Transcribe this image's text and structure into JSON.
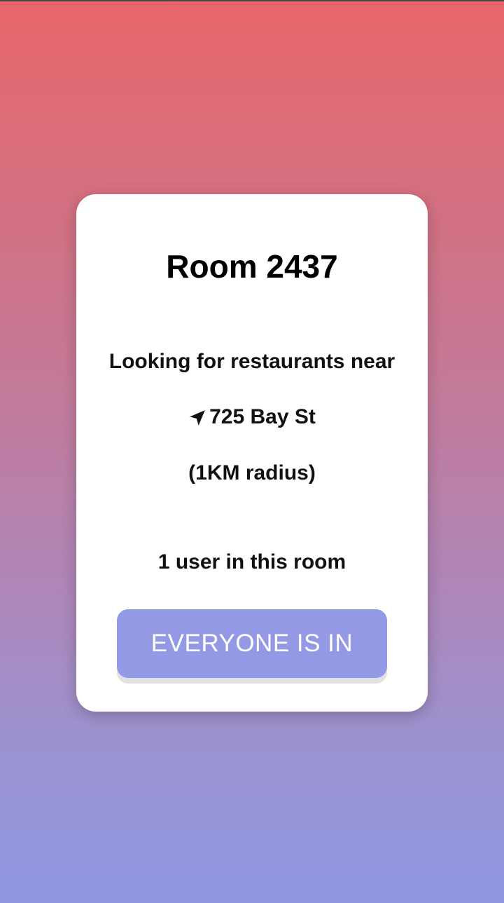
{
  "room": {
    "title": "Room 2437"
  },
  "location": {
    "looking_text": "Looking for restaurants near",
    "address": "725 Bay St",
    "radius": "(1KM radius)",
    "icon": "navigation-arrow-icon"
  },
  "users": {
    "count_text": "1 user in this room"
  },
  "actions": {
    "everyone_in_label": "EVERYONE IS IN"
  },
  "colors": {
    "gradient_top": "#e8666a",
    "gradient_bottom": "#9098e4",
    "button_bg": "#9499e6",
    "card_bg": "#ffffff"
  }
}
